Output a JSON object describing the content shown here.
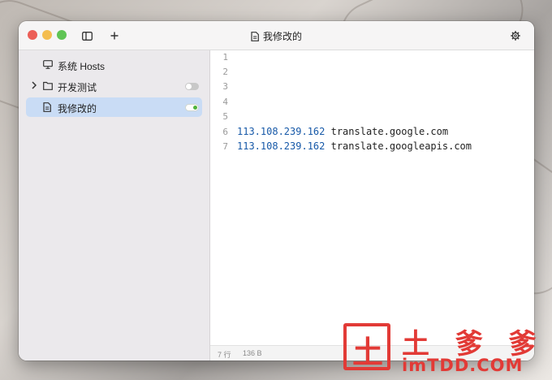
{
  "window": {
    "title": "我修改的",
    "icons": {
      "sidebar_toggle": "sidebar-icon",
      "add": "plus-icon",
      "settings": "gear-icon",
      "doc": "document-icon"
    }
  },
  "sidebar": {
    "items": [
      {
        "label": "系统 Hosts",
        "icon": "monitor-icon",
        "selected": false,
        "toggle": null
      },
      {
        "label": "开发测试",
        "icon": "folder-icon",
        "expandable": true,
        "selected": false,
        "toggle": "off"
      },
      {
        "label": "我修改的",
        "icon": "document-icon",
        "selected": true,
        "toggle": "on"
      }
    ]
  },
  "editor": {
    "lines": [
      {
        "num": "1",
        "ip": "",
        "host": ""
      },
      {
        "num": "2",
        "ip": "",
        "host": ""
      },
      {
        "num": "3",
        "ip": "",
        "host": ""
      },
      {
        "num": "4",
        "ip": "",
        "host": ""
      },
      {
        "num": "5",
        "ip": "",
        "host": ""
      },
      {
        "num": "6",
        "ip": "113.108.239.162",
        "host": " translate.google.com"
      },
      {
        "num": "7",
        "ip": "113.108.239.162",
        "host": " translate.googleapis.com"
      }
    ]
  },
  "status": {
    "lines": "7 行",
    "size": "136 B"
  },
  "watermark": {
    "glyph": "土",
    "title": "土 爹 爹",
    "url": "imTDD.COM"
  },
  "colors": {
    "ip": "#1759a8",
    "accent_selected": "#c9dcf5",
    "toggle_on": "#4fb43b",
    "watermark": "#e23a36"
  }
}
